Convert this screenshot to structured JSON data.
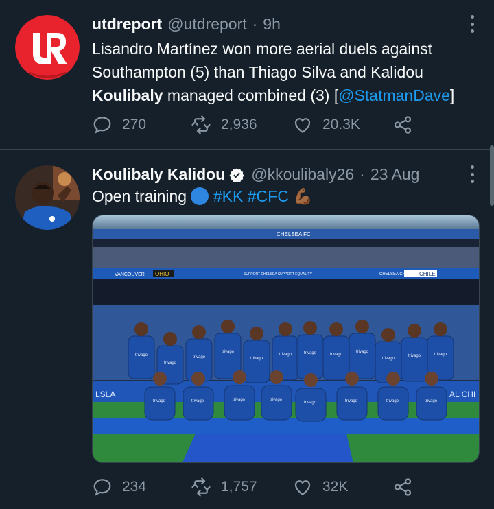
{
  "tweets": [
    {
      "display_name": "utdreport",
      "handle": "@utdreport",
      "sep": "·",
      "time": "9h",
      "text_part1": "Lisandro Martínez won more aerial duels against Southampton (5) than Thiago Silva and Kalidou ",
      "text_bold": "Koulibaly",
      "text_part2": " managed combined (3) [",
      "text_link": "@StatmanDave",
      "text_part3": "]",
      "replies": "270",
      "retweets": "2,936",
      "likes": "20.3K",
      "avatar_logo_text": "UR",
      "avatar_color": "#e8232d"
    },
    {
      "display_name": "Koulibaly Kalidou",
      "handle": "@kkoulibaly26",
      "sep": "·",
      "time": "23 Aug",
      "text_part1": "Open training ",
      "hashtag1": "#KK",
      "hashtag2": "#CFC",
      "emoji": "💪🏾",
      "replies": "234",
      "retweets": "1,757",
      "likes": "32K",
      "media": {
        "stand_sign": "CHELSEA FC",
        "ad_vancouver": "VANCOUVER",
        "ad_ohio": "OHIO",
        "ad_support": "SUPPORT CHELSEA  SUPPORT EQUALITY",
        "ad_croatia": "CHELSEA CROATIA",
        "ad_chile": "CHILE",
        "ad_lsla": "LSLA",
        "ad_alchi": "AL CHI",
        "shirt_sponsor": "trivago"
      }
    }
  ],
  "colors": {
    "background": "#15202b",
    "link": "#1d9bf0",
    "muted": "#8b98a5",
    "verified": "#1d9bf0",
    "chelsea_blue": "#1f4fa5"
  },
  "icons": [
    "reply-icon",
    "retweet-icon",
    "like-icon",
    "share-icon",
    "more-icon",
    "verified-badge-icon"
  ]
}
